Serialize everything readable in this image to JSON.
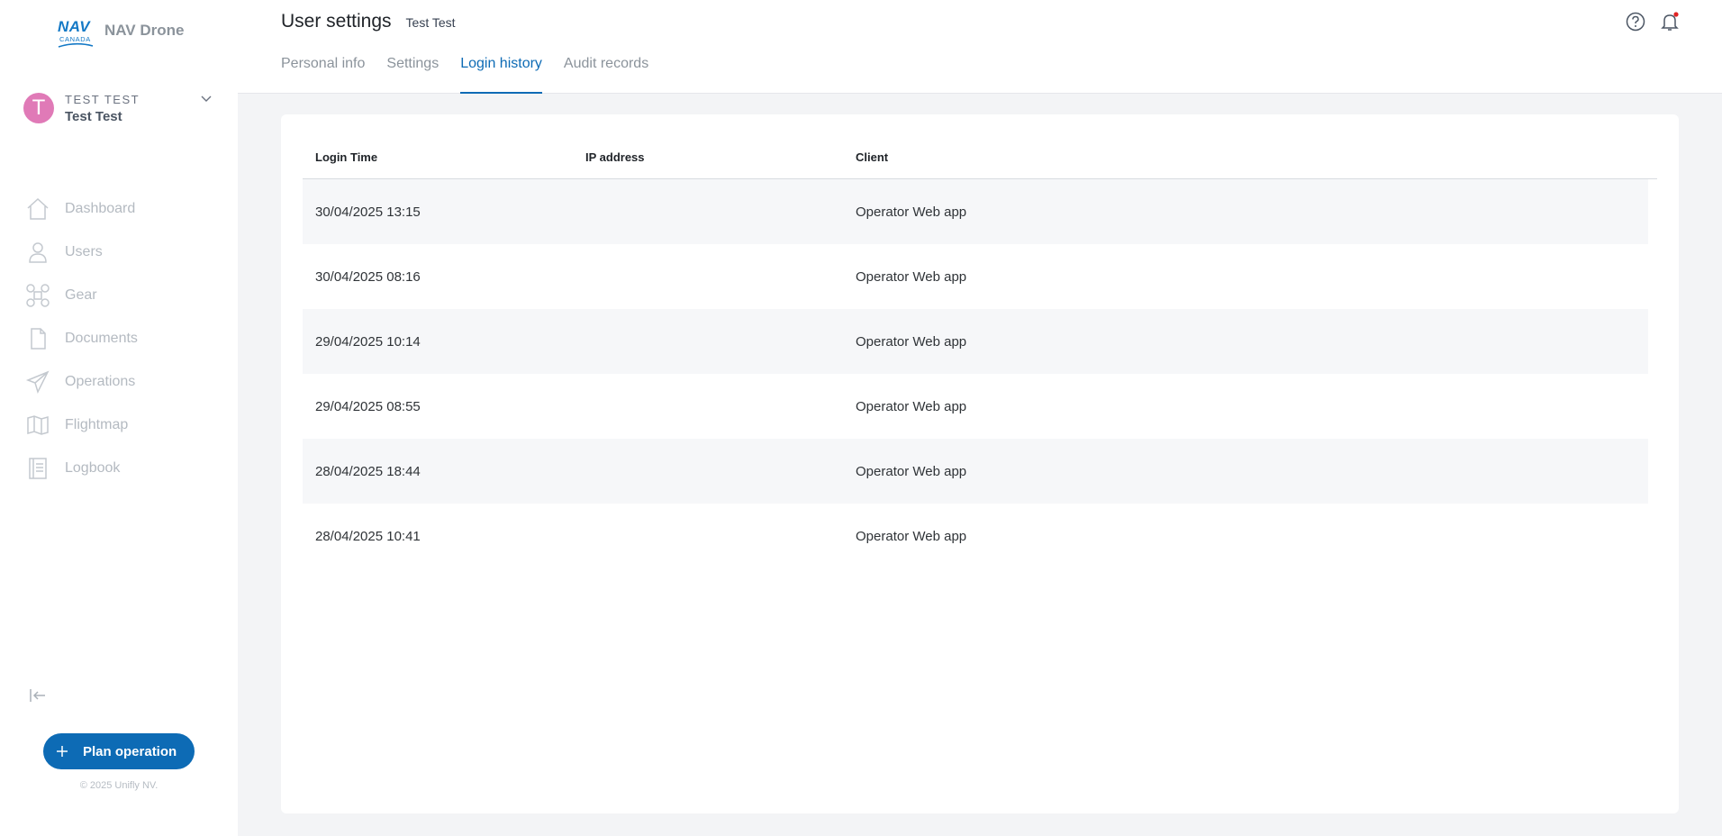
{
  "app": {
    "logo_nav": "NAV",
    "logo_canada": "CANADA",
    "title": "NAV Drone"
  },
  "user": {
    "initial": "T",
    "upper_name": "TEST TEST",
    "name": "Test Test"
  },
  "nav": [
    {
      "label": "Dashboard",
      "icon": "home-icon"
    },
    {
      "label": "Users",
      "icon": "user-icon"
    },
    {
      "label": "Gear",
      "icon": "drone-icon"
    },
    {
      "label": "Documents",
      "icon": "document-icon"
    },
    {
      "label": "Operations",
      "icon": "paper-plane-icon"
    },
    {
      "label": "Flightmap",
      "icon": "map-icon"
    },
    {
      "label": "Logbook",
      "icon": "logbook-icon"
    }
  ],
  "sidebar_footer": {
    "plan_button": "Plan operation",
    "copyright": "© 2025 Unifly NV."
  },
  "header": {
    "title": "User settings",
    "subtitle": "Test Test",
    "tabs": [
      {
        "label": "Personal info",
        "active": false
      },
      {
        "label": "Settings",
        "active": false
      },
      {
        "label": "Login history",
        "active": true
      },
      {
        "label": "Audit records",
        "active": false
      }
    ]
  },
  "colors": {
    "accent": "#0d6bb5",
    "avatar": "#e07ab7",
    "notification_dot": "#e02424"
  },
  "table": {
    "columns": [
      "Login Time",
      "IP address",
      "Client"
    ],
    "rows": [
      [
        "30/04/2025 13:15",
        "",
        "Operator Web app"
      ],
      [
        "30/04/2025 08:16",
        "",
        "Operator Web app"
      ],
      [
        "29/04/2025 10:14",
        "",
        "Operator Web app"
      ],
      [
        "29/04/2025 08:55",
        "",
        "Operator Web app"
      ],
      [
        "28/04/2025 18:44",
        "",
        "Operator Web app"
      ],
      [
        "28/04/2025 10:41",
        "",
        "Operator Web app"
      ]
    ]
  }
}
